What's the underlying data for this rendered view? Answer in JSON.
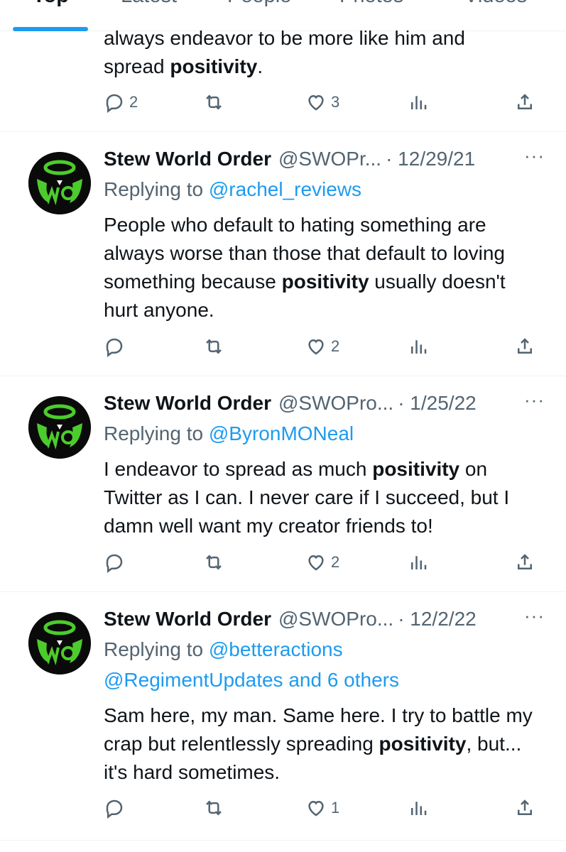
{
  "tabs": [
    {
      "label": "Top",
      "active": true
    },
    {
      "label": "Latest",
      "active": false
    },
    {
      "label": "People",
      "active": false
    },
    {
      "label": "Photos",
      "active": false
    },
    {
      "label": "Videos",
      "active": false
    }
  ],
  "first_tweet": {
    "text_line1": "always endeavor to be more like him and",
    "text_pre": "spread ",
    "text_bold": "positivity",
    "text_post": ".",
    "replies": "2",
    "retweets": "",
    "likes": "3"
  },
  "tweets": [
    {
      "name": "Stew World Order",
      "handle": "@SWOPr...",
      "date": "· 12/29/21",
      "more": "···",
      "replying_prefix": "Replying to ",
      "replying_to": "@rachel_reviews",
      "replying_to_2": "",
      "text_pre": "People who default to hating something are always worse than those that default to loving something because ",
      "text_bold": "positivity",
      "text_post": " usually doesn't hurt anyone.",
      "replies": "",
      "likes": "2"
    },
    {
      "name": "Stew World Order",
      "handle": "@SWOPro...",
      "date": "· 1/25/22",
      "more": "···",
      "replying_prefix": "Replying to ",
      "replying_to": "@ByronMONeal",
      "replying_to_2": "",
      "text_pre": "I endeavor to spread as much ",
      "text_bold": "positivity",
      "text_post": " on Twitter as I can. I never care if I succeed, but I damn well want my creator friends to!",
      "replies": "",
      "likes": "2"
    },
    {
      "name": "Stew World Order",
      "handle": "@SWOPro...",
      "date": "· 12/2/22",
      "more": "···",
      "replying_prefix": "Replying to ",
      "replying_to": "@betteractions",
      "replying_to_2": "@RegimentUpdates and 6 others",
      "text_pre": "Sam here, my man. Same here. I try to battle my crap but relentlessly spreading ",
      "text_bold": "positivity",
      "text_post": ", but... it's hard sometimes.",
      "replies": "",
      "likes": "1"
    }
  ],
  "colors": {
    "accent": "#1d9bf0",
    "secondary_text": "#536471",
    "avatar_green": "#4ccc2c"
  },
  "icons": [
    "reply-icon",
    "retweet-icon",
    "like-icon",
    "views-icon",
    "share-icon"
  ]
}
